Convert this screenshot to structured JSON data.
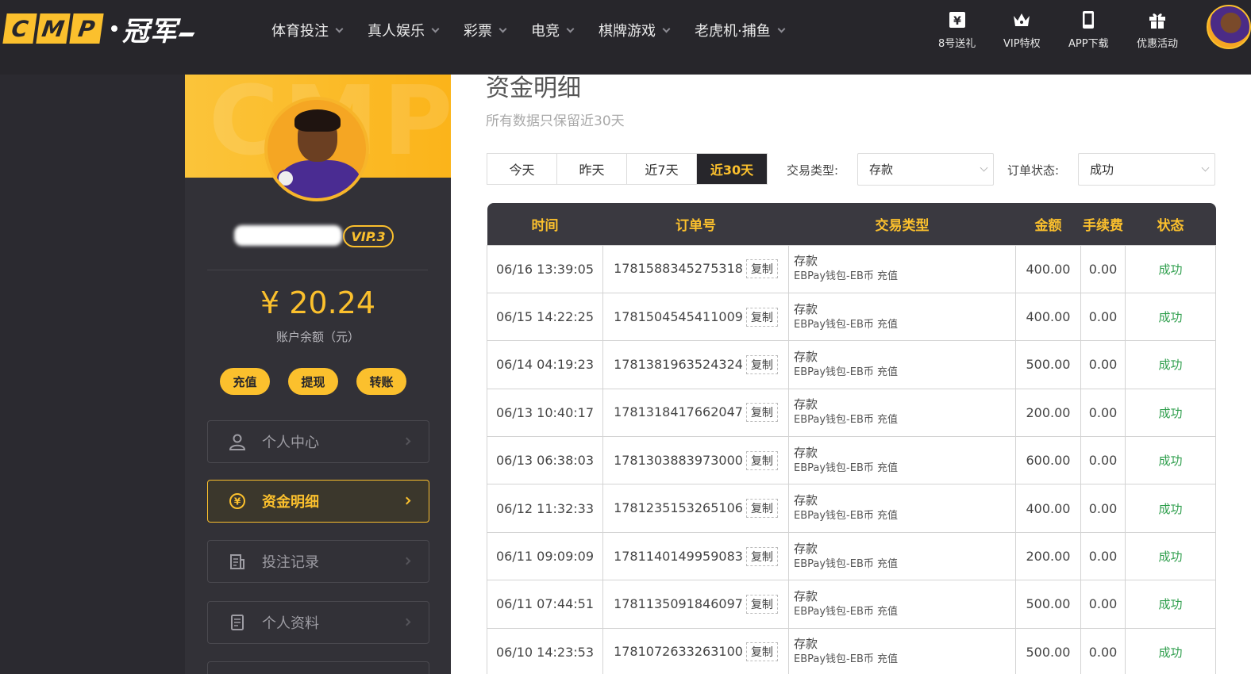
{
  "logo": {
    "tiles": [
      "C",
      "M",
      "P"
    ],
    "cn": "冠军"
  },
  "nav": [
    {
      "label": "体育投注"
    },
    {
      "label": "真人娱乐"
    },
    {
      "label": "彩票"
    },
    {
      "label": "电竞"
    },
    {
      "label": "棋牌游戏"
    },
    {
      "label": "老虎机·捕鱼"
    }
  ],
  "quick_links": [
    {
      "label": "8号送礼",
      "icon": "yuan-ticket-icon"
    },
    {
      "label": "VIP特权",
      "icon": "crown-icon"
    },
    {
      "label": "APP下载",
      "icon": "phone-icon"
    },
    {
      "label": "优惠活动",
      "icon": "gift-icon"
    }
  ],
  "sidebar": {
    "banner_watermark": "CMP",
    "vip_label": "VIP.3",
    "balance": "¥ 20.24",
    "balance_label": "账户余额（元）",
    "actions": [
      "充值",
      "提现",
      "转账"
    ],
    "menu": [
      {
        "label": "个人中心",
        "icon": "user-icon",
        "active": false
      },
      {
        "label": "资金明细",
        "icon": "yuan-circle-icon",
        "active": true
      },
      {
        "label": "投注记录",
        "icon": "bet-record-icon",
        "active": false
      },
      {
        "label": "个人资料",
        "icon": "profile-doc-icon",
        "active": false
      }
    ]
  },
  "main": {
    "title": "资金明细",
    "subtitle": "所有数据只保留近30天",
    "tabs": [
      {
        "label": "今天",
        "active": false
      },
      {
        "label": "昨天",
        "active": false
      },
      {
        "label": "近7天",
        "active": false
      },
      {
        "label": "近30天",
        "active": true
      }
    ],
    "filters": {
      "type_label": "交易类型:",
      "type_value": "存款",
      "status_label": "订单状态:",
      "status_value": "成功"
    },
    "table": {
      "columns": [
        "时间",
        "订单号",
        "交易类型",
        "金额",
        "手续费",
        "状态"
      ],
      "copy_label": "复制",
      "rows": [
        {
          "time": "06/16 13:39:05",
          "order": "1781588345275318",
          "type": "存款",
          "method": "EBPay钱包-EB币 充值",
          "amount": "400.00",
          "fee": "0.00",
          "status": "成功"
        },
        {
          "time": "06/15 14:22:25",
          "order": "1781504545411009",
          "type": "存款",
          "method": "EBPay钱包-EB币 充值",
          "amount": "400.00",
          "fee": "0.00",
          "status": "成功"
        },
        {
          "time": "06/14 04:19:23",
          "order": "1781381963524324",
          "type": "存款",
          "method": "EBPay钱包-EB币 充值",
          "amount": "500.00",
          "fee": "0.00",
          "status": "成功"
        },
        {
          "time": "06/13 10:40:17",
          "order": "1781318417662047",
          "type": "存款",
          "method": "EBPay钱包-EB币 充值",
          "amount": "200.00",
          "fee": "0.00",
          "status": "成功"
        },
        {
          "time": "06/13 06:38:03",
          "order": "1781303883973000",
          "type": "存款",
          "method": "EBPay钱包-EB币 充值",
          "amount": "600.00",
          "fee": "0.00",
          "status": "成功"
        },
        {
          "time": "06/12 11:32:33",
          "order": "1781235153265106",
          "type": "存款",
          "method": "EBPay钱包-EB币 充值",
          "amount": "400.00",
          "fee": "0.00",
          "status": "成功"
        },
        {
          "time": "06/11 09:09:09",
          "order": "1781140149959083",
          "type": "存款",
          "method": "EBPay钱包-EB币 充值",
          "amount": "200.00",
          "fee": "0.00",
          "status": "成功"
        },
        {
          "time": "06/11 07:44:51",
          "order": "1781135091846097",
          "type": "存款",
          "method": "EBPay钱包-EB币 充值",
          "amount": "500.00",
          "fee": "0.00",
          "status": "成功"
        },
        {
          "time": "06/10 14:23:53",
          "order": "1781072633263100",
          "type": "存款",
          "method": "EBPay钱包-EB币 充值",
          "amount": "500.00",
          "fee": "0.00",
          "status": "成功"
        }
      ]
    }
  },
  "colors": {
    "accent": "#fbc02d",
    "dark": "#27262b",
    "success": "#2e9e4c"
  }
}
